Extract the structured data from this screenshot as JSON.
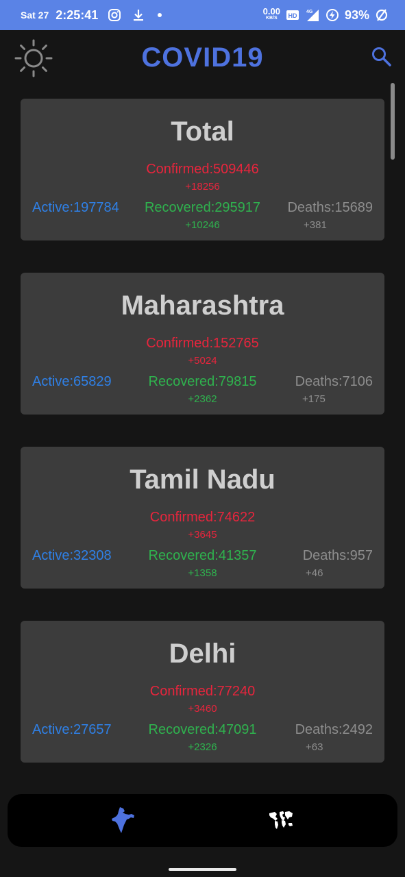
{
  "status_bar": {
    "date": "Sat 27",
    "time": "2:25:41",
    "net_speed": "0.00",
    "net_unit": "KB/S",
    "battery": "93%"
  },
  "app": {
    "title": "COVID19",
    "accent_color": "#4e72df"
  },
  "cards": [
    {
      "title": "Total",
      "confirmed": "Confirmed:509446",
      "confirmed_delta": "+18256",
      "active": "Active:197784",
      "recovered": "Recovered:295917",
      "recovered_delta": "+10246",
      "deaths": "Deaths:15689",
      "deaths_delta": "+381"
    },
    {
      "title": "Maharashtra",
      "confirmed": "Confirmed:152765",
      "confirmed_delta": "+5024",
      "active": "Active:65829",
      "recovered": "Recovered:79815",
      "recovered_delta": "+2362",
      "deaths": "Deaths:7106",
      "deaths_delta": "+175"
    },
    {
      "title": "Tamil Nadu",
      "confirmed": "Confirmed:74622",
      "confirmed_delta": "+3645",
      "active": "Active:32308",
      "recovered": "Recovered:41357",
      "recovered_delta": "+1358",
      "deaths": "Deaths:957",
      "deaths_delta": "+46"
    },
    {
      "title": "Delhi",
      "confirmed": "Confirmed:77240",
      "confirmed_delta": "+3460",
      "active": "Active:27657",
      "recovered": "Recovered:47091",
      "recovered_delta": "+2326",
      "deaths": "Deaths:2492",
      "deaths_delta": "+63"
    }
  ],
  "colors": {
    "confirmed": "#e8253d",
    "active": "#2f80e6",
    "recovered": "#2fb24e",
    "deaths": "#8d8d8d"
  },
  "bottom_nav": {
    "items": [
      {
        "icon": "india-map-icon",
        "selected": true
      },
      {
        "icon": "world-map-icon",
        "selected": false
      }
    ]
  }
}
